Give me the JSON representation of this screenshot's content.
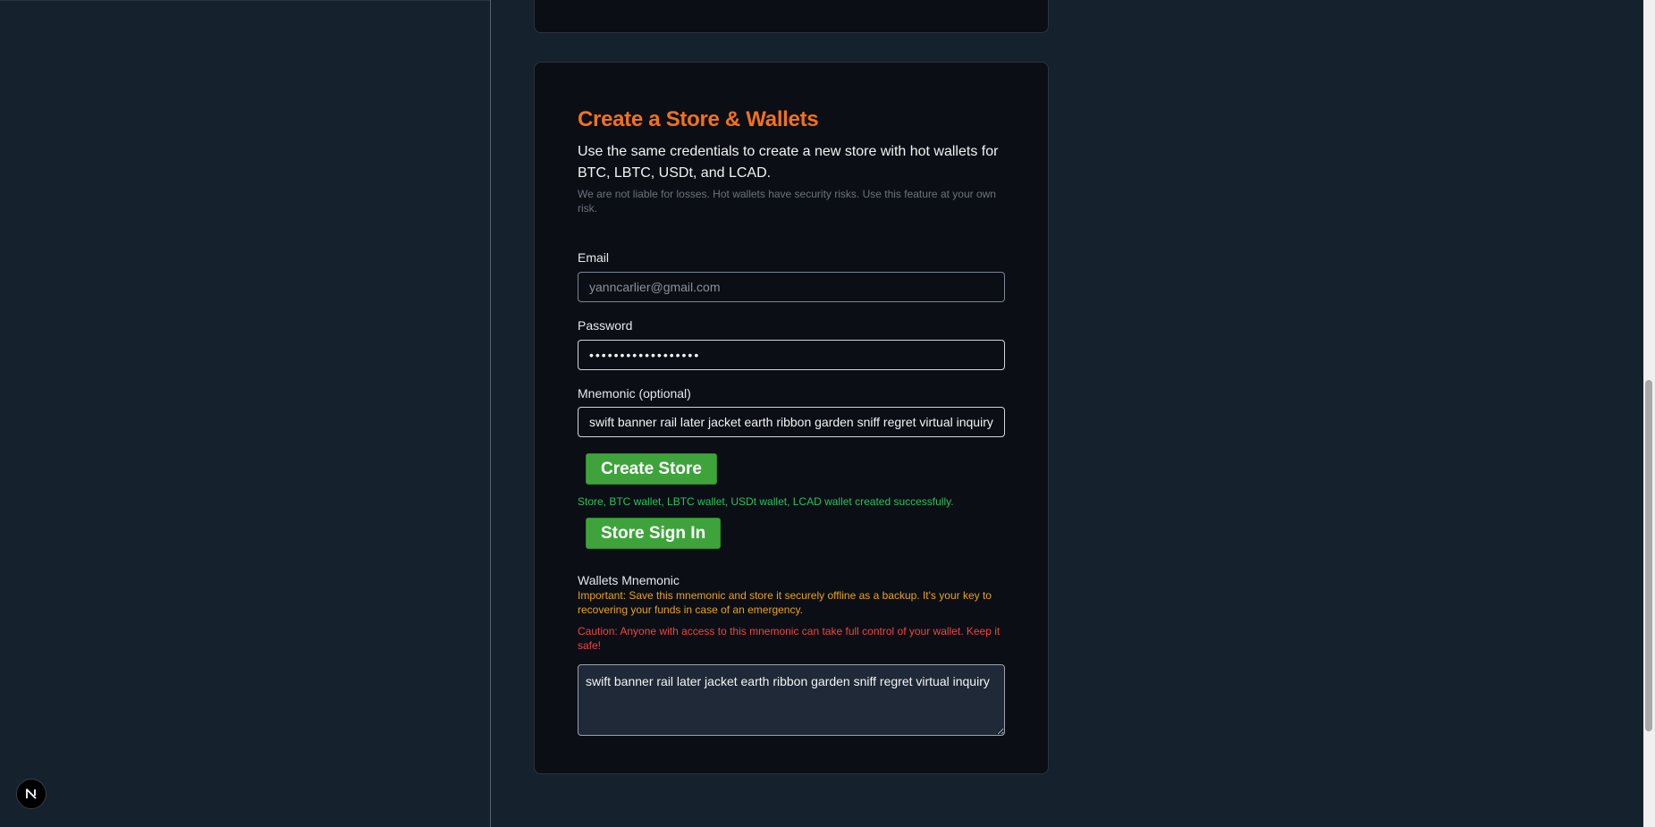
{
  "card": {
    "title": "Create a Store & Wallets",
    "description": "Use the same credentials to create a new store with hot wallets for BTC, LBTC, USDt, and LCAD.",
    "disclaimer": "We are not liable for losses. Hot wallets have security risks. Use this feature at your own risk."
  },
  "form": {
    "email_label": "Email",
    "email_placeholder": "yanncarlier@gmail.com",
    "email_value": "",
    "password_label": "Password",
    "password_value": "••••••••••••••••••",
    "mnemonic_label": "Mnemonic (optional)",
    "mnemonic_value": "swift banner rail later jacket earth ribbon garden sniff regret virtual inquiry"
  },
  "actions": {
    "create_store_label": "Create Store",
    "store_sign_in_label": "Store Sign In"
  },
  "status": {
    "success_message": "Store, BTC wallet, LBTC wallet, USDt wallet, LCAD wallet created successfully."
  },
  "wallets_mnemonic": {
    "label": "Wallets Mnemonic",
    "important": "Important: Save this mnemonic and store it securely offline as a backup. It's your key to recovering your funds in case of an emergency.",
    "caution": "Caution: Anyone with access to this mnemonic can take full control of your wallet. Keep it safe!",
    "value": "swift banner rail later jacket earth ribbon garden sniff regret virtual inquiry"
  },
  "badge": {
    "letter": "N",
    "icon": "nextjs-logo-icon"
  },
  "colors": {
    "accent_orange": "#f2711c",
    "button_green": "#3fa33c",
    "success_green": "#22c55e",
    "warning_amber": "#e8a317",
    "danger_red": "#ef4444",
    "card_bg": "#0b0e14",
    "page_bg": "#16212e"
  }
}
